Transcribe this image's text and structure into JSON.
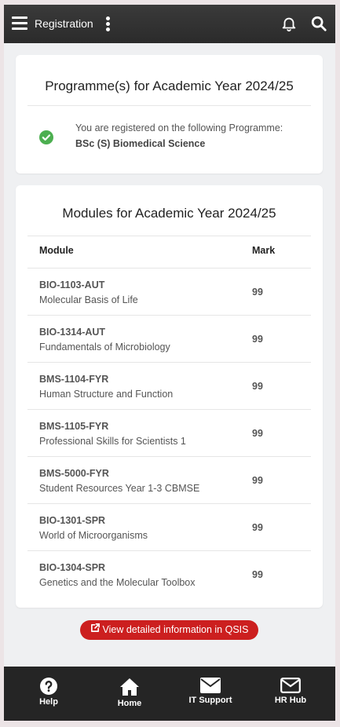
{
  "header": {
    "title": "Registration"
  },
  "programme_card": {
    "title": "Programme(s) for Academic Year 2024/25",
    "registered_text": "You are registered on the following Programme:",
    "programme": "BSc (S) Biomedical Science"
  },
  "modules_card": {
    "title": "Modules for Academic Year 2024/25",
    "col_module": "Module",
    "col_mark": "Mark",
    "rows": [
      {
        "code": "BIO-1103-AUT",
        "name": "Molecular Basis of Life",
        "mark": "99"
      },
      {
        "code": "BIO-1314-AUT",
        "name": "Fundamentals of Microbiology",
        "mark": "99"
      },
      {
        "code": "BMS-1104-FYR",
        "name": "Human Structure and Function",
        "mark": "99"
      },
      {
        "code": "BMS-1105-FYR",
        "name": "Professional Skills for Scientists 1",
        "mark": "99"
      },
      {
        "code": "BMS-5000-FYR",
        "name": "Student Resources Year 1-3 CBMSE",
        "mark": "99"
      },
      {
        "code": "BIO-1301-SPR",
        "name": "World of Microorganisms",
        "mark": "99"
      },
      {
        "code": "BIO-1304-SPR",
        "name": "Genetics and the Molecular Toolbox",
        "mark": "99"
      }
    ]
  },
  "qsis_button": {
    "label": "View detailed information in QSIS",
    "color": "#cc1f1f"
  },
  "bottom_nav": [
    {
      "label": "Help",
      "icon": "help-icon"
    },
    {
      "label": "Home",
      "icon": "home-icon"
    },
    {
      "label": "IT Support",
      "icon": "mail-icon"
    },
    {
      "label": "HR Hub",
      "icon": "mail-outline-icon"
    }
  ],
  "colors": {
    "topbar": "#2e2e2e",
    "check": "#4caf50",
    "bottombar": "#252525"
  }
}
